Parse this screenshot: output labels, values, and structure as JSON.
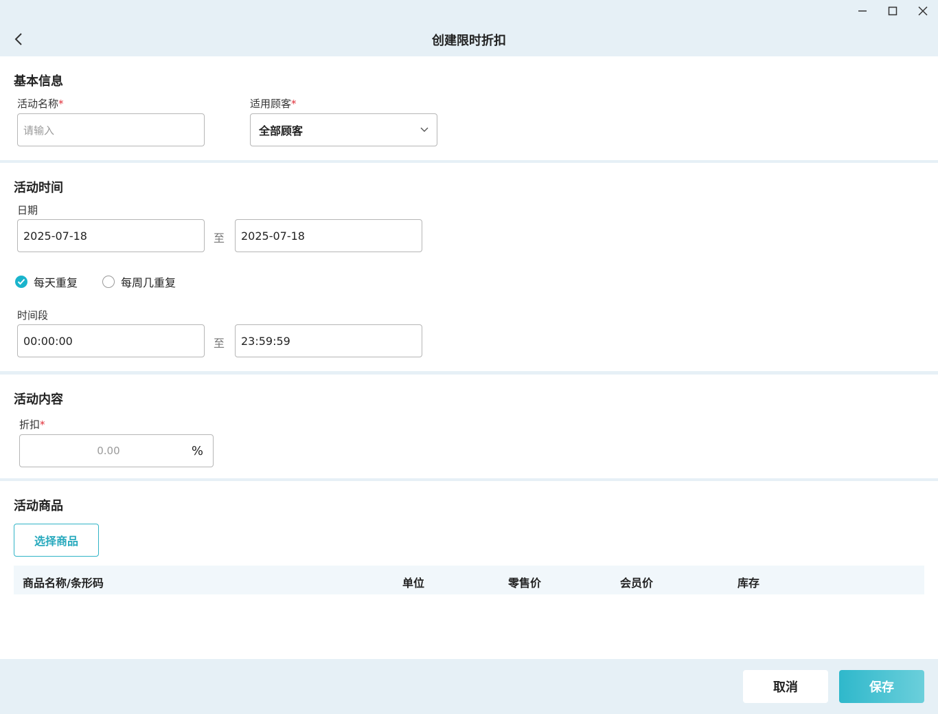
{
  "window": {
    "title": "创建限时折扣",
    "controls": [
      "minimize-icon",
      "maximize-icon",
      "close-icon"
    ]
  },
  "basic_info": {
    "section_title": "基本信息",
    "name_label": "活动名称",
    "name_placeholder": "请输入",
    "customer_label": "适用顾客",
    "customer_value": "全部顾客",
    "required_mark": "*"
  },
  "activity_time": {
    "section_title": "活动时间",
    "date_label": "日期",
    "start_date": "2025-07-18",
    "end_date": "2025-07-18",
    "to_text": "至",
    "repeat_daily": "每天重复",
    "repeat_weekly": "每周几重复",
    "repeat_selected": "daily",
    "period_label": "时间段",
    "start_time": "00:00:00",
    "end_time": "23:59:59"
  },
  "activity_content": {
    "section_title": "活动内容",
    "discount_label": "折扣",
    "discount_placeholder": "0.00",
    "discount_unit": "%"
  },
  "activity_goods": {
    "section_title": "活动商品",
    "select_button": "选择商品",
    "columns": [
      "商品名称/条形码",
      "单位",
      "零售价",
      "会员价",
      "库存"
    ]
  },
  "footer": {
    "cancel": "取消",
    "save": "保存"
  },
  "colors": {
    "accent": "#1ab4cc",
    "required": "#e0303a",
    "chrome": "#e6f0f6"
  }
}
